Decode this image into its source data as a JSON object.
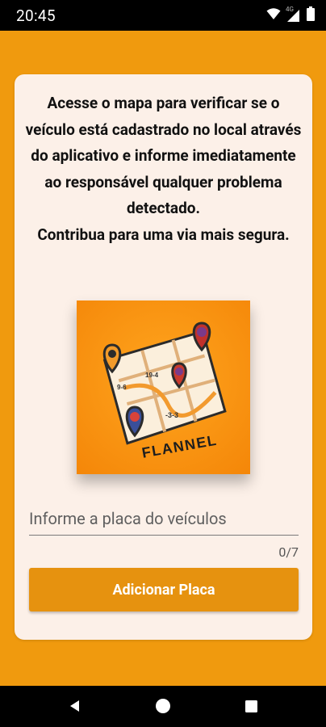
{
  "status_bar": {
    "time": "20:45",
    "network_label": "4G",
    "icons": [
      "wifi-icon",
      "signal-icon",
      "battery-icon"
    ]
  },
  "message": {
    "paragraph_1": "Acesse o mapa para verificar se o veículo está cadastrado no local através do aplicativo e informe imediatamente ao responsável qualquer problema detectado.",
    "paragraph_2": "Contribua para uma via mais segura."
  },
  "logo": {
    "text": "FLANNEL",
    "map_labels": [
      "9-6",
      "19-4",
      "-3-3"
    ]
  },
  "plate_input": {
    "placeholder": "Informe a placa do veículos",
    "value": "",
    "counter": "0/7"
  },
  "add_button": {
    "label": "Adicionar Placa"
  },
  "nav_bar": {
    "buttons": [
      "back-icon",
      "home-icon",
      "recents-icon"
    ]
  },
  "colors": {
    "app_background": "#F09A0E",
    "card_background": "#FCF0E8",
    "button": "#E6920F",
    "system_bars": "#000000"
  }
}
